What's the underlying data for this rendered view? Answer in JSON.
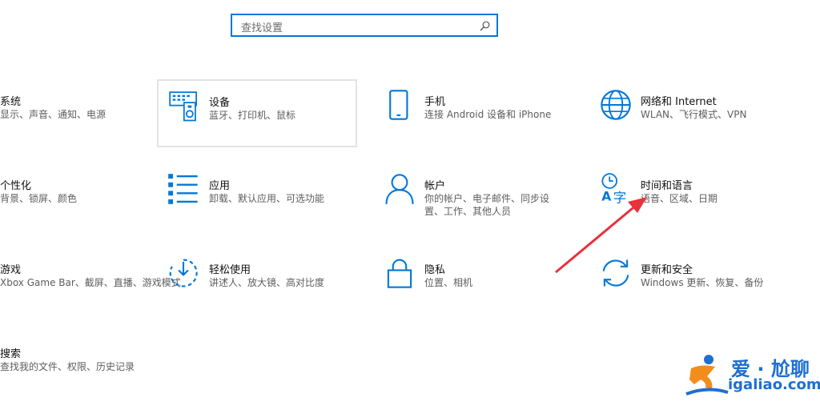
{
  "search": {
    "placeholder": "查找设置"
  },
  "tiles": [
    {
      "title": "系统",
      "desc": [
        "显示、声音、通知、电源"
      ],
      "icon": "system-icon"
    },
    {
      "title": "设备",
      "desc": [
        "蓝牙、打印机、鼠标"
      ],
      "icon": "devices-icon"
    },
    {
      "title": "手机",
      "desc": [
        "连接 Android 设备和 iPhone"
      ],
      "icon": "phone-icon"
    },
    {
      "title": "网络和 Internet",
      "desc": [
        "WLAN、飞行模式、VPN"
      ],
      "icon": "globe-icon"
    },
    {
      "title": "个性化",
      "desc": [
        "背景、锁屏、颜色"
      ],
      "icon": "personalization-icon"
    },
    {
      "title": "应用",
      "desc": [
        "卸载、默认应用、可选功能"
      ],
      "icon": "apps-list-icon"
    },
    {
      "title": "帐户",
      "desc": [
        "你的帐户、电子邮件、同步设",
        "置、工作、其他人员"
      ],
      "icon": "person-icon"
    },
    {
      "title": "时间和语言",
      "desc": [
        "语音、区域、日期"
      ],
      "icon": "time-language-icon"
    },
    {
      "title": "游戏",
      "desc": [
        "Xbox Game Bar、截屏、直播、游戏模式"
      ],
      "icon": "gaming-icon"
    },
    {
      "title": "轻松使用",
      "desc": [
        "讲述人、放大镜、高对比度"
      ],
      "icon": "ease-of-access-icon"
    },
    {
      "title": "隐私",
      "desc": [
        "位置、相机"
      ],
      "icon": "lock-icon"
    },
    {
      "title": "更新和安全",
      "desc": [
        "Windows 更新、恢复、备份"
      ],
      "icon": "sync-icon"
    },
    {
      "title": "搜索",
      "desc": [
        "查找我的文件、权限、历史记录"
      ],
      "icon": "search-icon"
    }
  ],
  "watermark": {
    "cn": "爱 · 尬聊",
    "en": "igaliao.com"
  },
  "colors": {
    "accent": "#0078d7",
    "arrow": "#e8323c"
  }
}
